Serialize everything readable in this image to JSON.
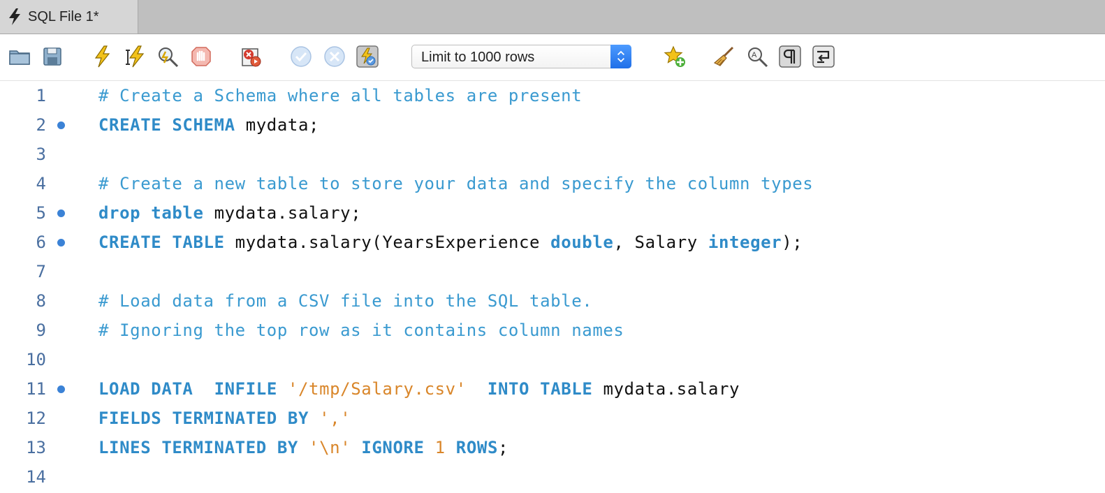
{
  "tab": {
    "title": "SQL File 1*",
    "icon": "lightning-icon"
  },
  "toolbar": {
    "buttons": [
      {
        "name": "open-file-button",
        "icon": "folder-icon"
      },
      {
        "name": "save-button",
        "icon": "save-icon"
      },
      {
        "name": "execute-button",
        "icon": "lightning-icon"
      },
      {
        "name": "execute-current-button",
        "icon": "lightning-cursor-icon"
      },
      {
        "name": "explain-button",
        "icon": "magnifier-lightning-icon"
      },
      {
        "name": "stop-button",
        "icon": "stop-hand-icon"
      },
      {
        "name": "stop-on-error-button",
        "icon": "stop-on-error-icon"
      },
      {
        "name": "commit-button",
        "icon": "check-icon"
      },
      {
        "name": "rollback-button",
        "icon": "x-circle-icon"
      },
      {
        "name": "autocommit-toggle",
        "icon": "autocommit-icon"
      },
      {
        "name": "add-snippet-button",
        "icon": "star-plus-icon"
      },
      {
        "name": "beautify-button",
        "icon": "broom-icon"
      },
      {
        "name": "find-replace-button",
        "icon": "find-icon"
      },
      {
        "name": "invisible-chars-toggle",
        "icon": "pilcrow-icon"
      },
      {
        "name": "word-wrap-toggle",
        "icon": "wrap-icon"
      }
    ],
    "limit_select": {
      "value": "Limit to 1000 rows"
    }
  },
  "editor": {
    "lines": [
      {
        "num": "1",
        "marker": false,
        "tokens": [
          [
            "comment",
            "# Create a Schema where all tables are present"
          ]
        ]
      },
      {
        "num": "2",
        "marker": true,
        "tokens": [
          [
            "kw",
            "CREATE"
          ],
          [
            "id",
            " "
          ],
          [
            "kw",
            "SCHEMA"
          ],
          [
            "id",
            " mydata"
          ],
          [
            "punc",
            ";"
          ]
        ]
      },
      {
        "num": "3",
        "marker": false,
        "tokens": []
      },
      {
        "num": "4",
        "marker": false,
        "tokens": [
          [
            "comment",
            "# Create a new table to store your data and specify the column types"
          ]
        ]
      },
      {
        "num": "5",
        "marker": true,
        "tokens": [
          [
            "kw",
            "drop"
          ],
          [
            "id",
            " "
          ],
          [
            "kw",
            "table"
          ],
          [
            "id",
            " mydata.salary"
          ],
          [
            "punc",
            ";"
          ]
        ]
      },
      {
        "num": "6",
        "marker": true,
        "tokens": [
          [
            "kw",
            "CREATE"
          ],
          [
            "id",
            " "
          ],
          [
            "kw",
            "TABLE"
          ],
          [
            "id",
            " mydata.salary(YearsExperience "
          ],
          [
            "kw",
            "double"
          ],
          [
            "id",
            ", Salary "
          ],
          [
            "kw",
            "integer"
          ],
          [
            "punc",
            ");"
          ]
        ]
      },
      {
        "num": "7",
        "marker": false,
        "tokens": []
      },
      {
        "num": "8",
        "marker": false,
        "tokens": [
          [
            "comment",
            "# Load data from a CSV file into the SQL table."
          ]
        ]
      },
      {
        "num": "9",
        "marker": false,
        "tokens": [
          [
            "comment",
            "# Ignoring the top row as it contains column names"
          ]
        ]
      },
      {
        "num": "10",
        "marker": false,
        "tokens": []
      },
      {
        "num": "11",
        "marker": true,
        "tokens": [
          [
            "kw",
            "LOAD"
          ],
          [
            "id",
            " "
          ],
          [
            "kw",
            "DATA"
          ],
          [
            "id",
            "  "
          ],
          [
            "kw",
            "INFILE"
          ],
          [
            "id",
            " "
          ],
          [
            "str",
            "'/tmp/Salary.csv'"
          ],
          [
            "id",
            "  "
          ],
          [
            "kw",
            "INTO"
          ],
          [
            "id",
            " "
          ],
          [
            "kw",
            "TABLE"
          ],
          [
            "id",
            " mydata.salary"
          ]
        ]
      },
      {
        "num": "12",
        "marker": false,
        "tokens": [
          [
            "kw",
            "FIELDS"
          ],
          [
            "id",
            " "
          ],
          [
            "kw",
            "TERMINATED"
          ],
          [
            "id",
            " "
          ],
          [
            "kw",
            "BY"
          ],
          [
            "id",
            " "
          ],
          [
            "str",
            "','"
          ]
        ]
      },
      {
        "num": "13",
        "marker": false,
        "tokens": [
          [
            "kw",
            "LINES"
          ],
          [
            "id",
            " "
          ],
          [
            "kw",
            "TERMINATED"
          ],
          [
            "id",
            " "
          ],
          [
            "kw",
            "BY"
          ],
          [
            "id",
            " "
          ],
          [
            "str",
            "'\\n'"
          ],
          [
            "id",
            " "
          ],
          [
            "kw",
            "IGNORE"
          ],
          [
            "id",
            " "
          ],
          [
            "num",
            "1"
          ],
          [
            "id",
            " "
          ],
          [
            "kw",
            "ROWS"
          ],
          [
            "punc",
            ";"
          ]
        ]
      },
      {
        "num": "14",
        "marker": false,
        "tokens": []
      }
    ]
  },
  "colors": {
    "comment": "#3a9ad0",
    "keyword": "#2f8bc8",
    "string": "#d9862a",
    "line_number": "#4a6fa0",
    "marker": "#3b82d6",
    "select_accent": "#1f6fe8"
  }
}
